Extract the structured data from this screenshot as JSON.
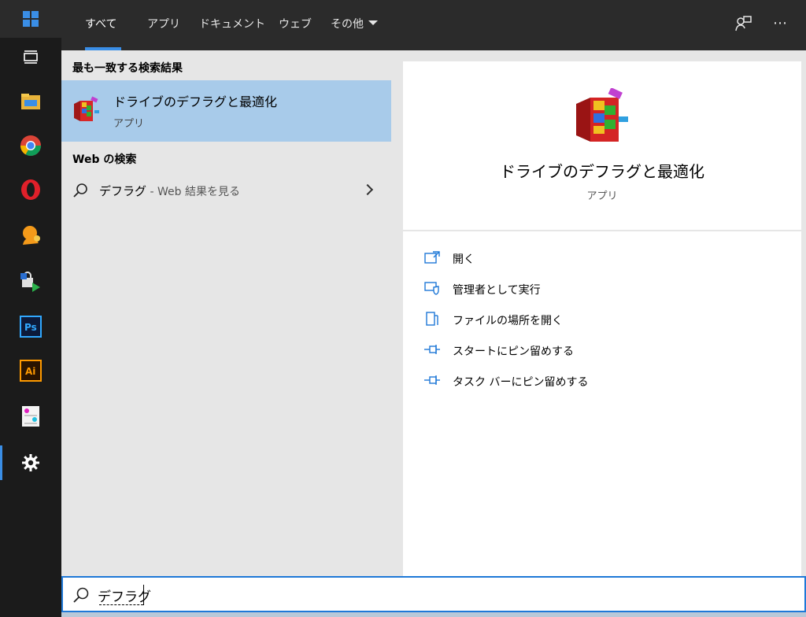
{
  "tabs": [
    {
      "label": "すべて",
      "active": true
    },
    {
      "label": "アプリ"
    },
    {
      "label": "ドキュメント"
    },
    {
      "label": "ウェブ"
    },
    {
      "label": "その他"
    }
  ],
  "results": {
    "best_match_heading": "最も一致する検索結果",
    "best_match": {
      "title": "ドライブのデフラグと最適化",
      "type": "アプリ"
    },
    "web_heading": "Web の検索",
    "web_item": {
      "query": "デフラグ",
      "suffix": " - Web 結果を見る"
    }
  },
  "detail": {
    "title": "ドライブのデフラグと最適化",
    "type": "アプリ",
    "actions": [
      {
        "label": "開く",
        "icon": "open-icon"
      },
      {
        "label": "管理者として実行",
        "icon": "shield-icon"
      },
      {
        "label": "ファイルの場所を開く",
        "icon": "file-location-icon"
      },
      {
        "label": "スタートにピン留めする",
        "icon": "pin-icon"
      },
      {
        "label": "タスク バーにピン留めする",
        "icon": "pin-icon"
      }
    ]
  },
  "search": {
    "value": "デフラグ"
  },
  "colors": {
    "accent": "#1e78d7",
    "selection": "#a8cbea",
    "panel": "#e6e6e6",
    "dark": "#2b2b2b"
  },
  "taskbar_icons": [
    "task-view-icon",
    "file-explorer-icon",
    "chrome-icon",
    "opera-icon",
    "user-app-icon",
    "lock-transfer-icon",
    "photoshop-icon",
    "illustrator-icon",
    "notepad-icon",
    "settings-icon"
  ]
}
